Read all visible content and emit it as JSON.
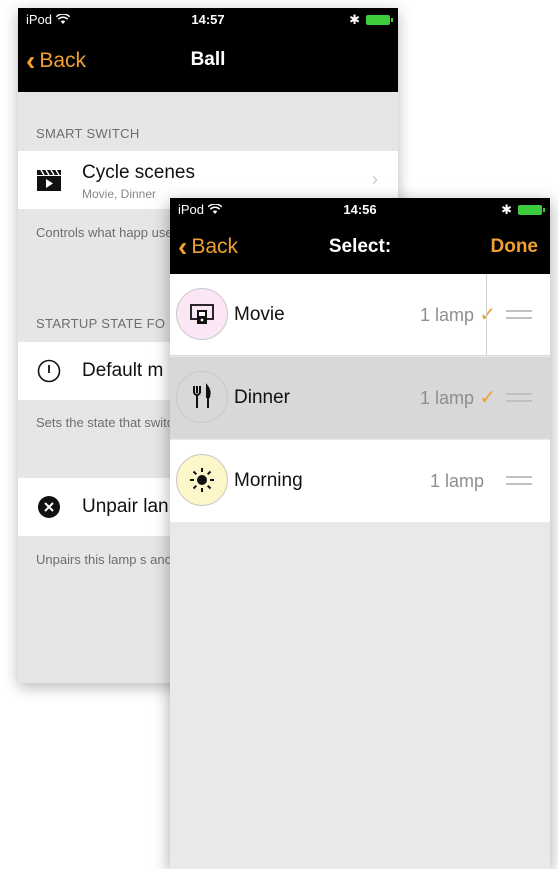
{
  "back_screen": {
    "status": {
      "carrier": "iPod",
      "time": "14:57"
    },
    "nav": {
      "back_label": "Back",
      "title": "Ball"
    },
    "smart_switch": {
      "header": "SMART SWITCH",
      "cycle_title": "Cycle scenes",
      "cycle_sub": "Movie, Dinner",
      "footer": "Controls what happ used to switch lam quickly flicked OFF"
    },
    "startup": {
      "header": "STARTUP STATE FO",
      "default_label": "Default m",
      "footer": "Sets the state that switch is turned ON"
    },
    "unpair": {
      "label": "Unpair lan",
      "footer": "Unpairs this lamp s another network."
    }
  },
  "front_screen": {
    "status": {
      "carrier": "iPod",
      "time": "14:56"
    },
    "nav": {
      "back_label": "Back",
      "title": "Select:",
      "done_label": "Done"
    },
    "scenes": [
      {
        "name": "Movie",
        "count": "1 lamp",
        "checked": true,
        "icon": "tv-icon",
        "icon_bg": "#fbe6f5"
      },
      {
        "name": "Dinner",
        "count": "1 lamp",
        "checked": true,
        "icon": "fork-knife-icon",
        "icon_bg": "#d8d8d8"
      },
      {
        "name": "Morning",
        "count": "1 lamp",
        "checked": false,
        "icon": "sun-icon",
        "icon_bg": "#fdf6c8"
      }
    ]
  },
  "colors": {
    "accent": "#f0a030",
    "battery": "#3ccc3c",
    "bar": "#000000"
  }
}
